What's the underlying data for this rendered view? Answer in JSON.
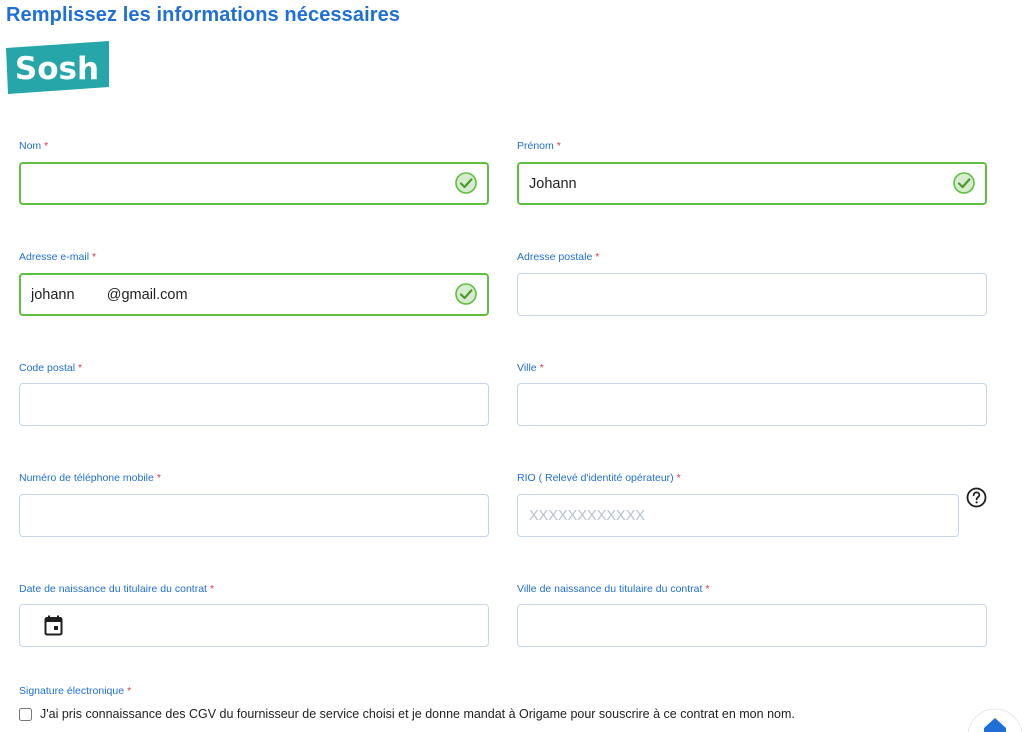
{
  "page": {
    "title": "Remplissez les informations nécessaires"
  },
  "brand": {
    "logo_text": "Sosh",
    "logo_color": "#26a6a8"
  },
  "required_mark": "*",
  "fields": {
    "nom": {
      "label": "Nom",
      "value": "",
      "placeholder": "",
      "valid": true
    },
    "prenom": {
      "label": "Prénom",
      "value": "Johann",
      "placeholder": "",
      "valid": true
    },
    "email": {
      "label": "Adresse e-mail",
      "value": "johann        @gmail.com",
      "placeholder": "",
      "valid": true
    },
    "adresse": {
      "label": "Adresse postale",
      "value": "",
      "placeholder": ""
    },
    "code_postal": {
      "label": "Code postal",
      "value": "",
      "placeholder": ""
    },
    "ville": {
      "label": "Ville",
      "value": "",
      "placeholder": ""
    },
    "telephone": {
      "label": "Numéro de téléphone mobile",
      "value": "",
      "placeholder": ""
    },
    "rio": {
      "label": "RIO ( Relevé d'identité opérateur)",
      "value": "",
      "placeholder": "XXXXXXXXXXXX"
    },
    "date_naissance": {
      "label": "Date de naissance du titulaire du contrat",
      "value": "",
      "placeholder": ""
    },
    "ville_naissance": {
      "label": "Ville de naissance du titulaire du contrat",
      "value": "",
      "placeholder": ""
    }
  },
  "signature": {
    "label": "Signature électronique",
    "consent_text": "J'ai pris connaissance des CGV du fournisseur de service choisi et je donne mandat à Origame pour souscrire à ce contrat en mon nom.",
    "checked": false
  },
  "icons": {
    "valid": "check-circle-icon",
    "help": "question-circle-icon",
    "date": "calendar-icon",
    "home": "home-icon"
  },
  "colors": {
    "accent": "#1f6fd6",
    "valid": "#5fbf3f",
    "required": "#e0344b",
    "border": "#c7d6e6"
  }
}
